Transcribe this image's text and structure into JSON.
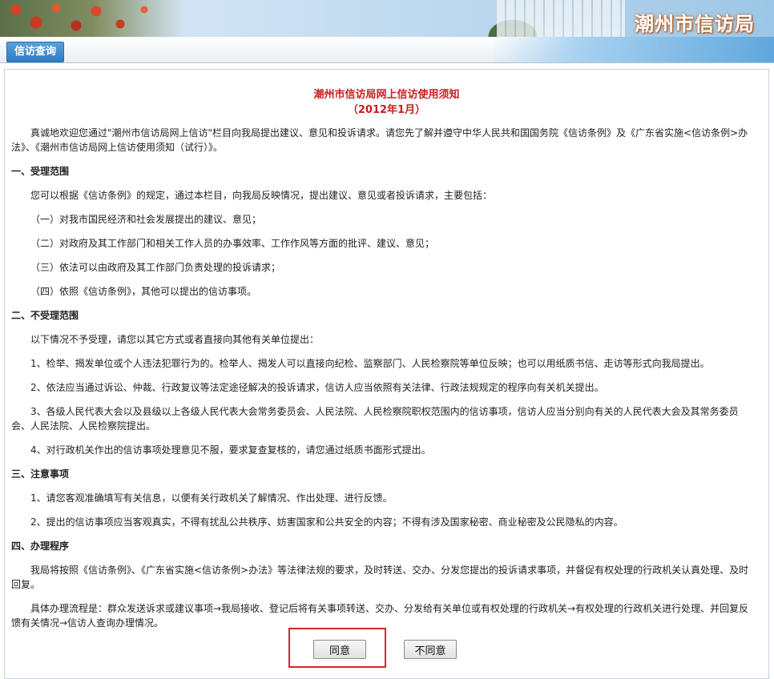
{
  "header": {
    "site_title": "潮州市信访局"
  },
  "nav": {
    "tab_label": "信访查询"
  },
  "document": {
    "title_line1": "潮州市信访局网上信访使用须知",
    "title_line2": "（2012年1月）",
    "paragraphs": [
      {
        "text": "真诚地欢迎您通过\"潮州市信访局网上信访\"栏目向我局提出建议、意见和投诉请求。请您先了解并遵守中华人民共和国国务院《信访条例》及《广东省实施<信访条例>办法》、《潮州市信访局网上信访使用须知（试行）》。",
        "style": "ind"
      },
      {
        "text": "一、受理范围",
        "style": "h"
      },
      {
        "text": "您可以根据《信访条例》的规定，通过本栏目，向我局反映情况，提出建议、意见或者投诉请求，主要包括：",
        "style": "ind"
      },
      {
        "text": "（一）对我市国民经济和社会发展提出的建议、意见；",
        "style": "ind"
      },
      {
        "text": "（二）对政府及其工作部门和相关工作人员的办事效率、工作作风等方面的批评、建议、意见；",
        "style": "ind"
      },
      {
        "text": "（三）依法可以由政府及其工作部门负责处理的投诉请求；",
        "style": "ind"
      },
      {
        "text": "（四）依照《信访条例》，其他可以提出的信访事项。",
        "style": "ind"
      },
      {
        "text": "二、不受理范围",
        "style": "h"
      },
      {
        "text": "以下情况不予受理，请您以其它方式或者直接向其他有关单位提出：",
        "style": "ind"
      },
      {
        "text": "1、检举、揭发单位或个人违法犯罪行为的。检举人、揭发人可以直接向纪检、监察部门、人民检察院等单位反映；也可以用纸质书信、走访等形式向我局提出。",
        "style": "ind"
      },
      {
        "text": "2、依法应当通过诉讼、仲裁、行政复议等法定途径解决的投诉请求，信访人应当依照有关法律、行政法规规定的程序向有关机关提出。",
        "style": "ind"
      },
      {
        "text": "3、各级人民代表大会以及县级以上各级人民代表大会常务委员会、人民法院、人民检察院职权范围内的信访事项，信访人应当分别向有关的人民代表大会及其常务委员会、人民法院、人民检察院提出。",
        "style": "ind"
      },
      {
        "text": "4、对行政机关作出的信访事项处理意见不服，要求复查复核的，请您通过纸质书面形式提出。",
        "style": "ind"
      },
      {
        "text": "三、注意事项",
        "style": "h"
      },
      {
        "text": "1、请您客观准确填写有关信息，以便有关行政机关了解情况、作出处理、进行反馈。",
        "style": "ind"
      },
      {
        "text": "2、提出的信访事项应当客观真实，不得有扰乱公共秩序、妨害国家和公共安全的内容；不得有涉及国家秘密、商业秘密及公民隐私的内容。",
        "style": "ind"
      },
      {
        "text": "四、办理程序",
        "style": "h"
      },
      {
        "text": "我局将按照《信访条例》、《广东省实施<信访条例>办法》等法律法规的要求，及时转送、交办、分发您提出的投诉请求事项，并督促有权处理的行政机关认真处理、及时回复。",
        "style": "ind"
      },
      {
        "text": "具体办理流程是：群众发送诉求或建议事项→我局接收、登记后将有关事项转送、交办、分发给有关单位或有权处理的行政机关→有权处理的行政机关进行处理、并回复反馈有关情况→信访人查询办理情况。",
        "style": "ind"
      }
    ]
  },
  "actions": {
    "agree_label": "同意",
    "disagree_label": "不同意"
  },
  "colors": {
    "title_red": "#c81e1e",
    "tab_blue": "#2e7cc4",
    "highlight_red": "#d8232a"
  }
}
